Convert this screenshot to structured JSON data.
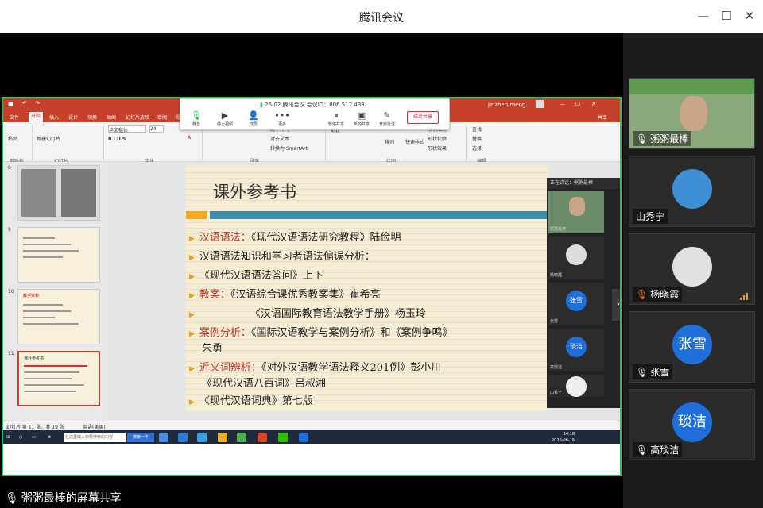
{
  "app": {
    "title": "腾讯会议",
    "window_controls": [
      "minimize",
      "maximize",
      "close"
    ]
  },
  "meeting_toolbar": {
    "timer": "26:02",
    "meeting_info": "腾讯会议 会议ID：806 512 438",
    "tools": [
      {
        "label": "静音",
        "icon": "mic-icon"
      },
      {
        "label": "停止视频",
        "icon": "camera-icon"
      },
      {
        "label": "成员",
        "icon": "members-icon"
      },
      {
        "label": "更多",
        "icon": "more-icon"
      },
      {
        "label": "暂停共享",
        "icon": "pause-share-icon"
      },
      {
        "label": "新的共享",
        "icon": "new-share-icon"
      },
      {
        "label": "开启批注",
        "icon": "annotate-icon"
      }
    ],
    "end_share_label": "结束共享"
  },
  "ppt": {
    "tabs": [
      "文件",
      "开始",
      "插入",
      "设计",
      "切换",
      "动画",
      "幻灯片放映",
      "审阅",
      "视图"
    ],
    "active_tab": "开始",
    "user": "jinzhen meng",
    "share_label": "共享",
    "ribbon_groups": [
      "剪贴板",
      "幻灯片",
      "字体",
      "段落",
      "绘图",
      "编辑"
    ],
    "ribbon_buttons": {
      "paste": "粘贴",
      "new_slide": "新建幻灯片",
      "font_name": "华文楷体",
      "font_size": "24",
      "text_direction": "文字方向",
      "align_text": "对齐文本",
      "smartart": "转换为 SmartArt",
      "shapes": "形状",
      "arrange": "排列",
      "quick_styles": "快速样式",
      "shape_fill": "形状填充",
      "shape_outline": "形状轮廓",
      "shape_effects": "形状效果",
      "find": "查找",
      "replace": "替换",
      "select": "选择"
    },
    "thumbnails": [
      {
        "num": "8",
        "title": ""
      },
      {
        "num": "9",
        "title": ""
      },
      {
        "num": "10",
        "title": "教学资料"
      },
      {
        "num": "11",
        "title": "课外参考书"
      }
    ],
    "slide": {
      "title": "课外参考书",
      "bullets": [
        {
          "label": "汉语语法：",
          "text": "《现代汉语语法研究教程》陆俭明"
        },
        {
          "label": "",
          "text": "汉语语法知识和学习者语法偏误分析："
        },
        {
          "label": "",
          "text": "《现代汉语语法答问》上下"
        },
        {
          "label": "教案：",
          "text": "《汉语综合课优秀教案集》崔希亮"
        },
        {
          "label": "",
          "text": "《汉语国际教育语法教学手册》杨玉玲"
        },
        {
          "label": "案例分析：",
          "text": "《国际汉语教学与案例分析》和《案例争鸣》"
        },
        {
          "label": "",
          "text": "朱勇"
        },
        {
          "label": "近义词辨析：",
          "text": "《对外汉语教学语法释义201例》彭小川"
        },
        {
          "label": "",
          "text": "《现代汉语八百词》吕叔湘"
        },
        {
          "label": "",
          "text": "《现代汉语词典》第七版"
        }
      ]
    },
    "status": {
      "slide_count": "幻灯片 第 11 张，共 19 张",
      "language": "英语(美国)"
    }
  },
  "taskbar": {
    "search_placeholder": "在这里输入你要搜索的内容",
    "search_button": "搜索一下",
    "time": "14:18",
    "date": "2020-06-16"
  },
  "speaker_panel": {
    "header": "正在讲话：粥粥最棒",
    "tiles": [
      {
        "name": "粥粥最棒",
        "type": "video"
      },
      {
        "name": "杨晓霞",
        "type": "avatar"
      },
      {
        "name": "张雪",
        "type": "circle",
        "initials": "张雪"
      },
      {
        "name": "高琰洁",
        "type": "circle",
        "initials": "琰洁"
      },
      {
        "name": "山秀宁",
        "type": "avatar"
      }
    ]
  },
  "participants": [
    {
      "name": "粥粥最棒",
      "type": "video",
      "mic": "on"
    },
    {
      "name": "山秀宁",
      "type": "avatar-blue",
      "mic": "none"
    },
    {
      "name": "杨晓霞",
      "type": "avatar-gray",
      "mic": "muted",
      "signal": true
    },
    {
      "name": "张雪",
      "type": "circle",
      "initials": "张雪",
      "mic": "muted",
      "color": "#1e6fd9"
    },
    {
      "name": "高琰洁",
      "type": "circle",
      "initials": "琰洁",
      "mic": "muted",
      "color": "#1e6fd9"
    }
  ],
  "share_label": "粥粥最棒的屏幕共享",
  "colors": {
    "share_border": "#22c55e",
    "ppt_red": "#c5412b",
    "accent_blue": "#1e6fd9",
    "bullet_red": "#c0392b"
  }
}
